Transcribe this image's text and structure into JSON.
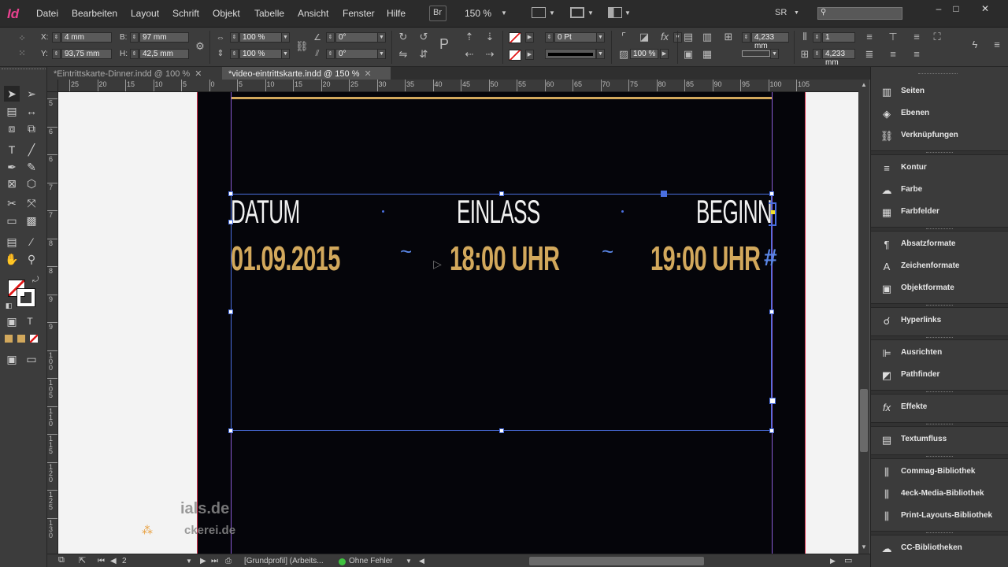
{
  "app": {
    "logo": "Id",
    "menu": [
      "Datei",
      "Bearbeiten",
      "Layout",
      "Schrift",
      "Objekt",
      "Tabelle",
      "Ansicht",
      "Fenster",
      "Hilfe"
    ],
    "bridge_label": "Br",
    "zoom": "150 %",
    "workspace": "SR"
  },
  "controlbar": {
    "x_label": "X:",
    "x_value": "4 mm",
    "y_label": "Y:",
    "y_value": "93,75 mm",
    "w_label": "B:",
    "w_value": "97 mm",
    "h_label": "H:",
    "h_value": "42,5 mm",
    "scale_x": "100 %",
    "scale_y": "100 %",
    "angle_1": "0°",
    "angle_2": "0°",
    "stroke_weight": "0 Pt",
    "opacity": "100 %",
    "offset_1": "4,233 mm",
    "offset_2": "4,233 mm",
    "columns": "1"
  },
  "tabs": [
    {
      "label": "*Eintrittskarte-Dinner.indd @ 100 %",
      "active": false
    },
    {
      "label": "*video-eintrittskarte.indd @ 150 %",
      "active": true
    }
  ],
  "ruler": {
    "h_ticks": [
      "25",
      "20",
      "15",
      "10",
      "5",
      "0",
      "5",
      "10",
      "15",
      "20",
      "25",
      "30",
      "35",
      "40",
      "45",
      "50",
      "55",
      "60",
      "65",
      "70",
      "75",
      "80",
      "85",
      "90",
      "95",
      "100",
      "105"
    ],
    "v_ticks": [
      "5",
      "6",
      "6",
      "7",
      "7",
      "8",
      "8",
      "9",
      "9",
      "100",
      "105",
      "110",
      "115",
      "120",
      "125",
      "130"
    ]
  },
  "card": {
    "label_date": "DATUM",
    "label_entry": "EINLASS",
    "label_start": "BEGINN",
    "value_date": "01.09.2015",
    "value_entry": "18:00 UHR",
    "value_start": "19:00 UHR",
    "separator": "~",
    "overflow_mark": "#"
  },
  "statusbar": {
    "page": "2",
    "profile": "[Grundprofil] (Arbeits...",
    "preflight": "Ohne Fehler"
  },
  "watermark": {
    "line1": "ials.de",
    "line2": "ckerei.de"
  },
  "panels": {
    "group1": [
      "Seiten",
      "Ebenen",
      "Verknüpfungen"
    ],
    "group2": [
      "Kontur",
      "Farbe",
      "Farbfelder"
    ],
    "group3": [
      "Absatzformate",
      "Zeichenformate",
      "Objektformate"
    ],
    "group4": [
      "Hyperlinks"
    ],
    "group5": [
      "Ausrichten",
      "Pathfinder"
    ],
    "group6": [
      "Effekte"
    ],
    "group7": [
      "Textumfluss"
    ],
    "group8": [
      "Commag-Bibliothek",
      "4eck-Media-Bibliothek",
      "Print-Layouts-Bibliothek"
    ],
    "group9": [
      "CC-Bibliotheken"
    ]
  },
  "colors": {
    "gold": "#d2a85c",
    "frame_blue": "#4a6fe0",
    "card_bg": "#05050a",
    "logo_pink": "#e8418f"
  }
}
